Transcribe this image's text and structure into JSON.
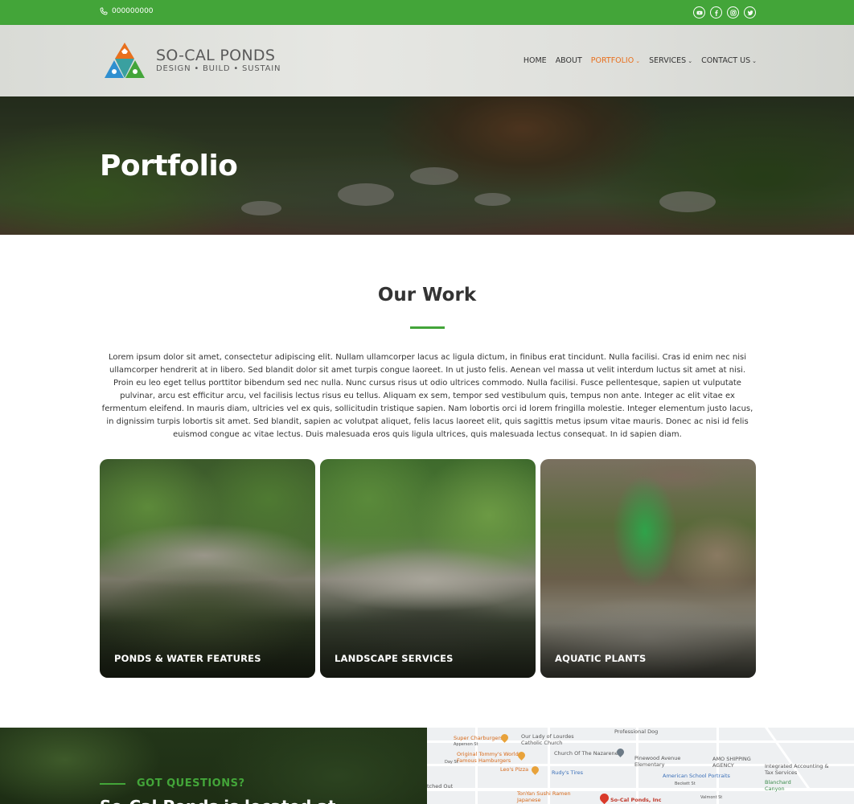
{
  "topbar": {
    "phone": "000000000",
    "socials": [
      "youtube-icon",
      "facebook-icon",
      "instagram-icon",
      "twitter-icon"
    ]
  },
  "logo": {
    "name": "SO-CAL PONDS",
    "tagline": "DESIGN • BUILD • SUSTAIN"
  },
  "nav": {
    "items": [
      {
        "label": "HOME",
        "dropdown": false
      },
      {
        "label": "ABOUT",
        "dropdown": false
      },
      {
        "label": "PORTFOLIO",
        "dropdown": true,
        "active": true
      },
      {
        "label": "SERVICES",
        "dropdown": true
      },
      {
        "label": "CONTACT US",
        "dropdown": true
      }
    ]
  },
  "hero": {
    "title": "Portfolio"
  },
  "work": {
    "title": "Our Work",
    "intro": "Lorem ipsum dolor sit amet, consectetur adipiscing elit. Nullam ullamcorper lacus ac ligula dictum, in finibus erat tincidunt. Nulla facilisi. Cras id enim nec nisi ullamcorper hendrerit at in libero. Sed blandit dolor sit amet turpis congue laoreet. In ut justo felis.  Aenean vel massa ut velit interdum luctus sit amet at nisi. Proin eu leo eget tellus porttitor bibendum sed nec nulla. Nunc cursus risus ut odio ultrices commodo. Nulla facilisi. Fusce pellentesque, sapien ut vulputate pulvinar, arcu est efficitur arcu, vel facilisis lectus risus eu tellus. Aliquam ex sem, tempor sed vestibulum quis, tempus non ante. Integer ac elit vitae ex fermentum eleifend. In mauris diam, ultricies vel ex quis, sollicitudin tristique sapien. Nam lobortis orci id lorem fringilla molestie. Integer elementum justo lacus, in dignissim turpis lobortis sit amet. Sed blandit, sapien ac volutpat aliquet, felis lacus laoreet elit, quis sagittis metus ipsum vitae mauris. Donec ac nisi id felis euismod congue ac vitae lectus. Duis malesuada eros quis ligula ultrices, quis malesuada lectus consequat. In id sapien diam.",
    "cards": [
      {
        "label": "PONDS & WATER FEATURES"
      },
      {
        "label": "LANDSCAPE SERVICES"
      },
      {
        "label": "AQUATIC PLANTS"
      }
    ]
  },
  "contact": {
    "eyebrow": "GOT QUESTIONS?",
    "heading": "So-Cal Ponds is located at"
  },
  "map": {
    "labels": [
      "Super Charburgers",
      "Our Lady of Lourdes Catholic Church",
      "Professional Dog",
      "Original Tommy's World Famous Hamburgers",
      "Church Of The Nazarene",
      "Pinewood Avenue Elementary",
      "AMO SHIPPING AGENCY",
      "Integrated Accounting & Tax Services",
      "Leo's Pizza",
      "Rudy's Tires",
      "American School Portraits",
      "Blanchard Canyon",
      "TonYan Sushi Ramen Japanese",
      "So-Cal Ponds, Inc",
      "Apperson St",
      "Foothill Blvd",
      "Day St",
      "Valmont St",
      "Beckett St",
      "Pinewood Ave",
      "Tenhaven Ave",
      "tched Out",
      "Stacy St",
      "Blanchard Canyon Rd"
    ]
  },
  "colors": {
    "brand_green": "#43a539",
    "nav_active": "#e86f1c"
  }
}
